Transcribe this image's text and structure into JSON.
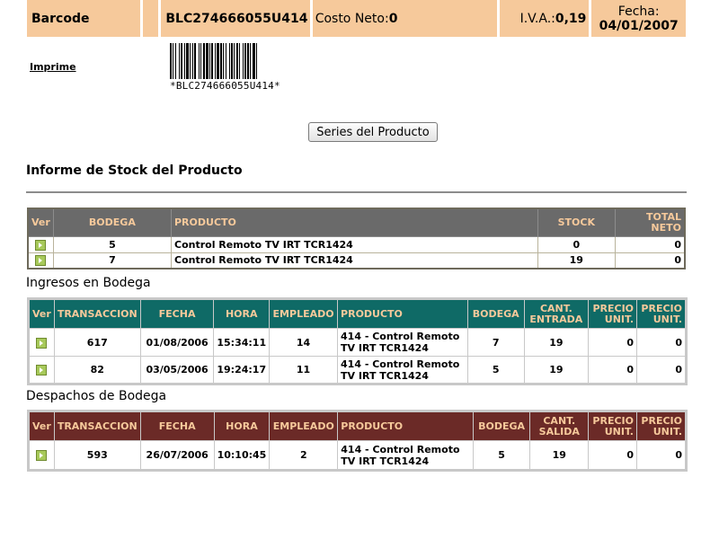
{
  "header": {
    "barcode_label": "Barcode",
    "barcode_value": "BLC274666055U414",
    "costo_label": "Costo Neto:",
    "costo_value": "0",
    "iva_label": "I.V.A.:",
    "iva_value": "0,19",
    "fecha_label": "Fecha:",
    "fecha_value": "04/01/2007"
  },
  "print_link": "Imprime",
  "barcode_text": "*BLC274666055U414*",
  "series_button": "Series del Producto",
  "stock_report": {
    "title": "Informe de Stock del Producto",
    "columns": [
      "Ver",
      "BODEGA",
      "PRODUCTO",
      "STOCK",
      "TOTAL NETO"
    ],
    "rows": [
      {
        "bodega": "5",
        "producto": "Control Remoto TV IRT TCR1424",
        "stock": "0",
        "total_neto": "0"
      },
      {
        "bodega": "7",
        "producto": "Control Remoto TV IRT TCR1424",
        "stock": "19",
        "total_neto": "0"
      }
    ]
  },
  "ingresos": {
    "title": "Ingresos en Bodega",
    "columns": [
      "Ver",
      "TRANSACCION",
      "FECHA",
      "HORA",
      "EMPLEADO",
      "PRODUCTO",
      "BODEGA",
      "CANT. ENTRADA",
      "PRECIO UNIT.",
      "PRECIO UNIT."
    ],
    "rows": [
      {
        "transaccion": "617",
        "fecha": "01/08/2006",
        "hora": "15:34:11",
        "empleado": "14",
        "producto": "414 - Control Remoto TV IRT TCR1424",
        "bodega": "7",
        "cant": "19",
        "precio1": "0",
        "precio2": "0"
      },
      {
        "transaccion": "82",
        "fecha": "03/05/2006",
        "hora": "19:24:17",
        "empleado": "11",
        "producto": "414 - Control Remoto TV IRT TCR1424",
        "bodega": "5",
        "cant": "19",
        "precio1": "0",
        "precio2": "0"
      }
    ]
  },
  "despachos": {
    "title": "Despachos de Bodega",
    "columns": [
      "Ver",
      "TRANSACCION",
      "FECHA",
      "HORA",
      "EMPLEADO",
      "PRODUCTO",
      "BODEGA",
      "CANT. SALIDA",
      "PRECIO UNIT.",
      "PRECIO UNIT."
    ],
    "rows": [
      {
        "transaccion": "593",
        "fecha": "26/07/2006",
        "hora": "10:10:45",
        "empleado": "2",
        "producto": "414 - Control Remoto TV IRT TCR1424",
        "bodega": "5",
        "cant": "19",
        "precio1": "0",
        "precio2": "0"
      }
    ]
  },
  "colors": {
    "header_bg": "#f6c99b",
    "stock_header_bg": "#6a6a6a",
    "ingresos_header_bg": "#0f6a66",
    "despachos_header_bg": "#6b2a27",
    "header_text": "#f6c99b",
    "ver_icon": "#a7c95a"
  },
  "icons": {
    "ver": "play-arrow-icon",
    "barcode": "barcode-image"
  }
}
